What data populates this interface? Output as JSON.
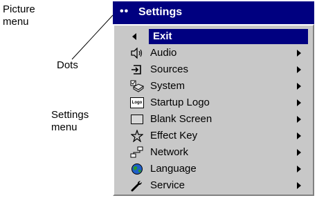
{
  "annotations": {
    "picture_menu": "Picture\nmenu",
    "dots": "Dots",
    "settings_menu": "Settings\nmenu"
  },
  "menu": {
    "title_dots": "••",
    "title": "Settings",
    "items": [
      {
        "label": "Exit",
        "icon": "back-arrow-icon",
        "selected": true,
        "submenu": false
      },
      {
        "label": "Audio",
        "icon": "speaker-icon",
        "selected": false,
        "submenu": true
      },
      {
        "label": "Sources",
        "icon": "source-input-icon",
        "selected": false,
        "submenu": true
      },
      {
        "label": "System",
        "icon": "system-icon",
        "selected": false,
        "submenu": true
      },
      {
        "label": "Startup Logo",
        "icon": "logo-icon",
        "selected": false,
        "submenu": true
      },
      {
        "label": "Blank Screen",
        "icon": "blank-screen-icon",
        "selected": false,
        "submenu": true
      },
      {
        "label": "Effect Key",
        "icon": "star-icon",
        "selected": false,
        "submenu": true
      },
      {
        "label": "Network",
        "icon": "network-icon",
        "selected": false,
        "submenu": true
      },
      {
        "label": "Language",
        "icon": "globe-icon",
        "selected": false,
        "submenu": true
      },
      {
        "label": "Service",
        "icon": "wrench-icon",
        "selected": false,
        "submenu": true
      }
    ],
    "logo_icon_text": "Logo"
  },
  "colors": {
    "title_bar": "#000080",
    "menu_bg": "#c8c8c8",
    "selected_bg": "#000080"
  }
}
